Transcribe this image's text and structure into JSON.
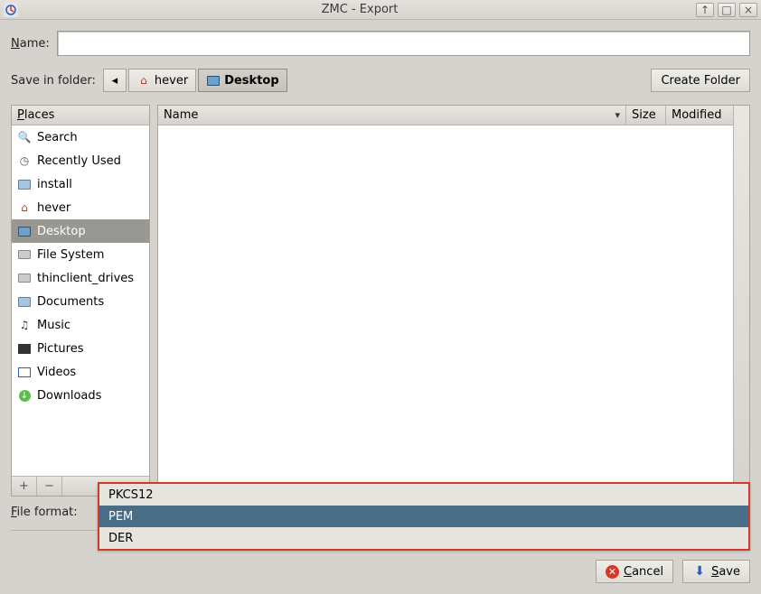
{
  "window": {
    "title": "ZMC - Export",
    "buttons": {
      "min": "↑",
      "max": "□",
      "close": "×"
    }
  },
  "form": {
    "name_label": "Name:",
    "name_value": "",
    "save_in_label": "Save in folder:",
    "path": {
      "back": "◂",
      "home": "hever",
      "current": "Desktop"
    },
    "create_folder": "Create Folder"
  },
  "places": {
    "header": "Places",
    "items": [
      {
        "name": "search",
        "label": "Search",
        "icon": "search",
        "selected": false
      },
      {
        "name": "recent",
        "label": "Recently Used",
        "icon": "clock",
        "selected": false
      },
      {
        "name": "install",
        "label": "install",
        "icon": "folder",
        "selected": false
      },
      {
        "name": "home",
        "label": "hever",
        "icon": "home",
        "selected": false
      },
      {
        "name": "desktop",
        "label": "Desktop",
        "icon": "desktop",
        "selected": true
      },
      {
        "name": "filesystem",
        "label": "File System",
        "icon": "drive",
        "selected": false
      },
      {
        "name": "thinclient",
        "label": "thinclient_drives",
        "icon": "drive",
        "selected": false
      },
      {
        "name": "documents",
        "label": "Documents",
        "icon": "folder",
        "selected": false
      },
      {
        "name": "music",
        "label": "Music",
        "icon": "music",
        "selected": false
      },
      {
        "name": "pictures",
        "label": "Pictures",
        "icon": "picture",
        "selected": false
      },
      {
        "name": "videos",
        "label": "Videos",
        "icon": "video",
        "selected": false
      },
      {
        "name": "downloads",
        "label": "Downloads",
        "icon": "download",
        "selected": false
      }
    ],
    "footer": {
      "add": "+",
      "remove": "−"
    }
  },
  "filelist": {
    "columns": {
      "name": "Name",
      "size": "Size",
      "modified": "Modified"
    }
  },
  "file_format": {
    "label": "File format:",
    "options": [
      {
        "value": "PKCS12",
        "selected": false
      },
      {
        "value": "PEM",
        "selected": true
      },
      {
        "value": "DER",
        "selected": false
      }
    ]
  },
  "actions": {
    "cancel": "Cancel",
    "save": "Save"
  }
}
